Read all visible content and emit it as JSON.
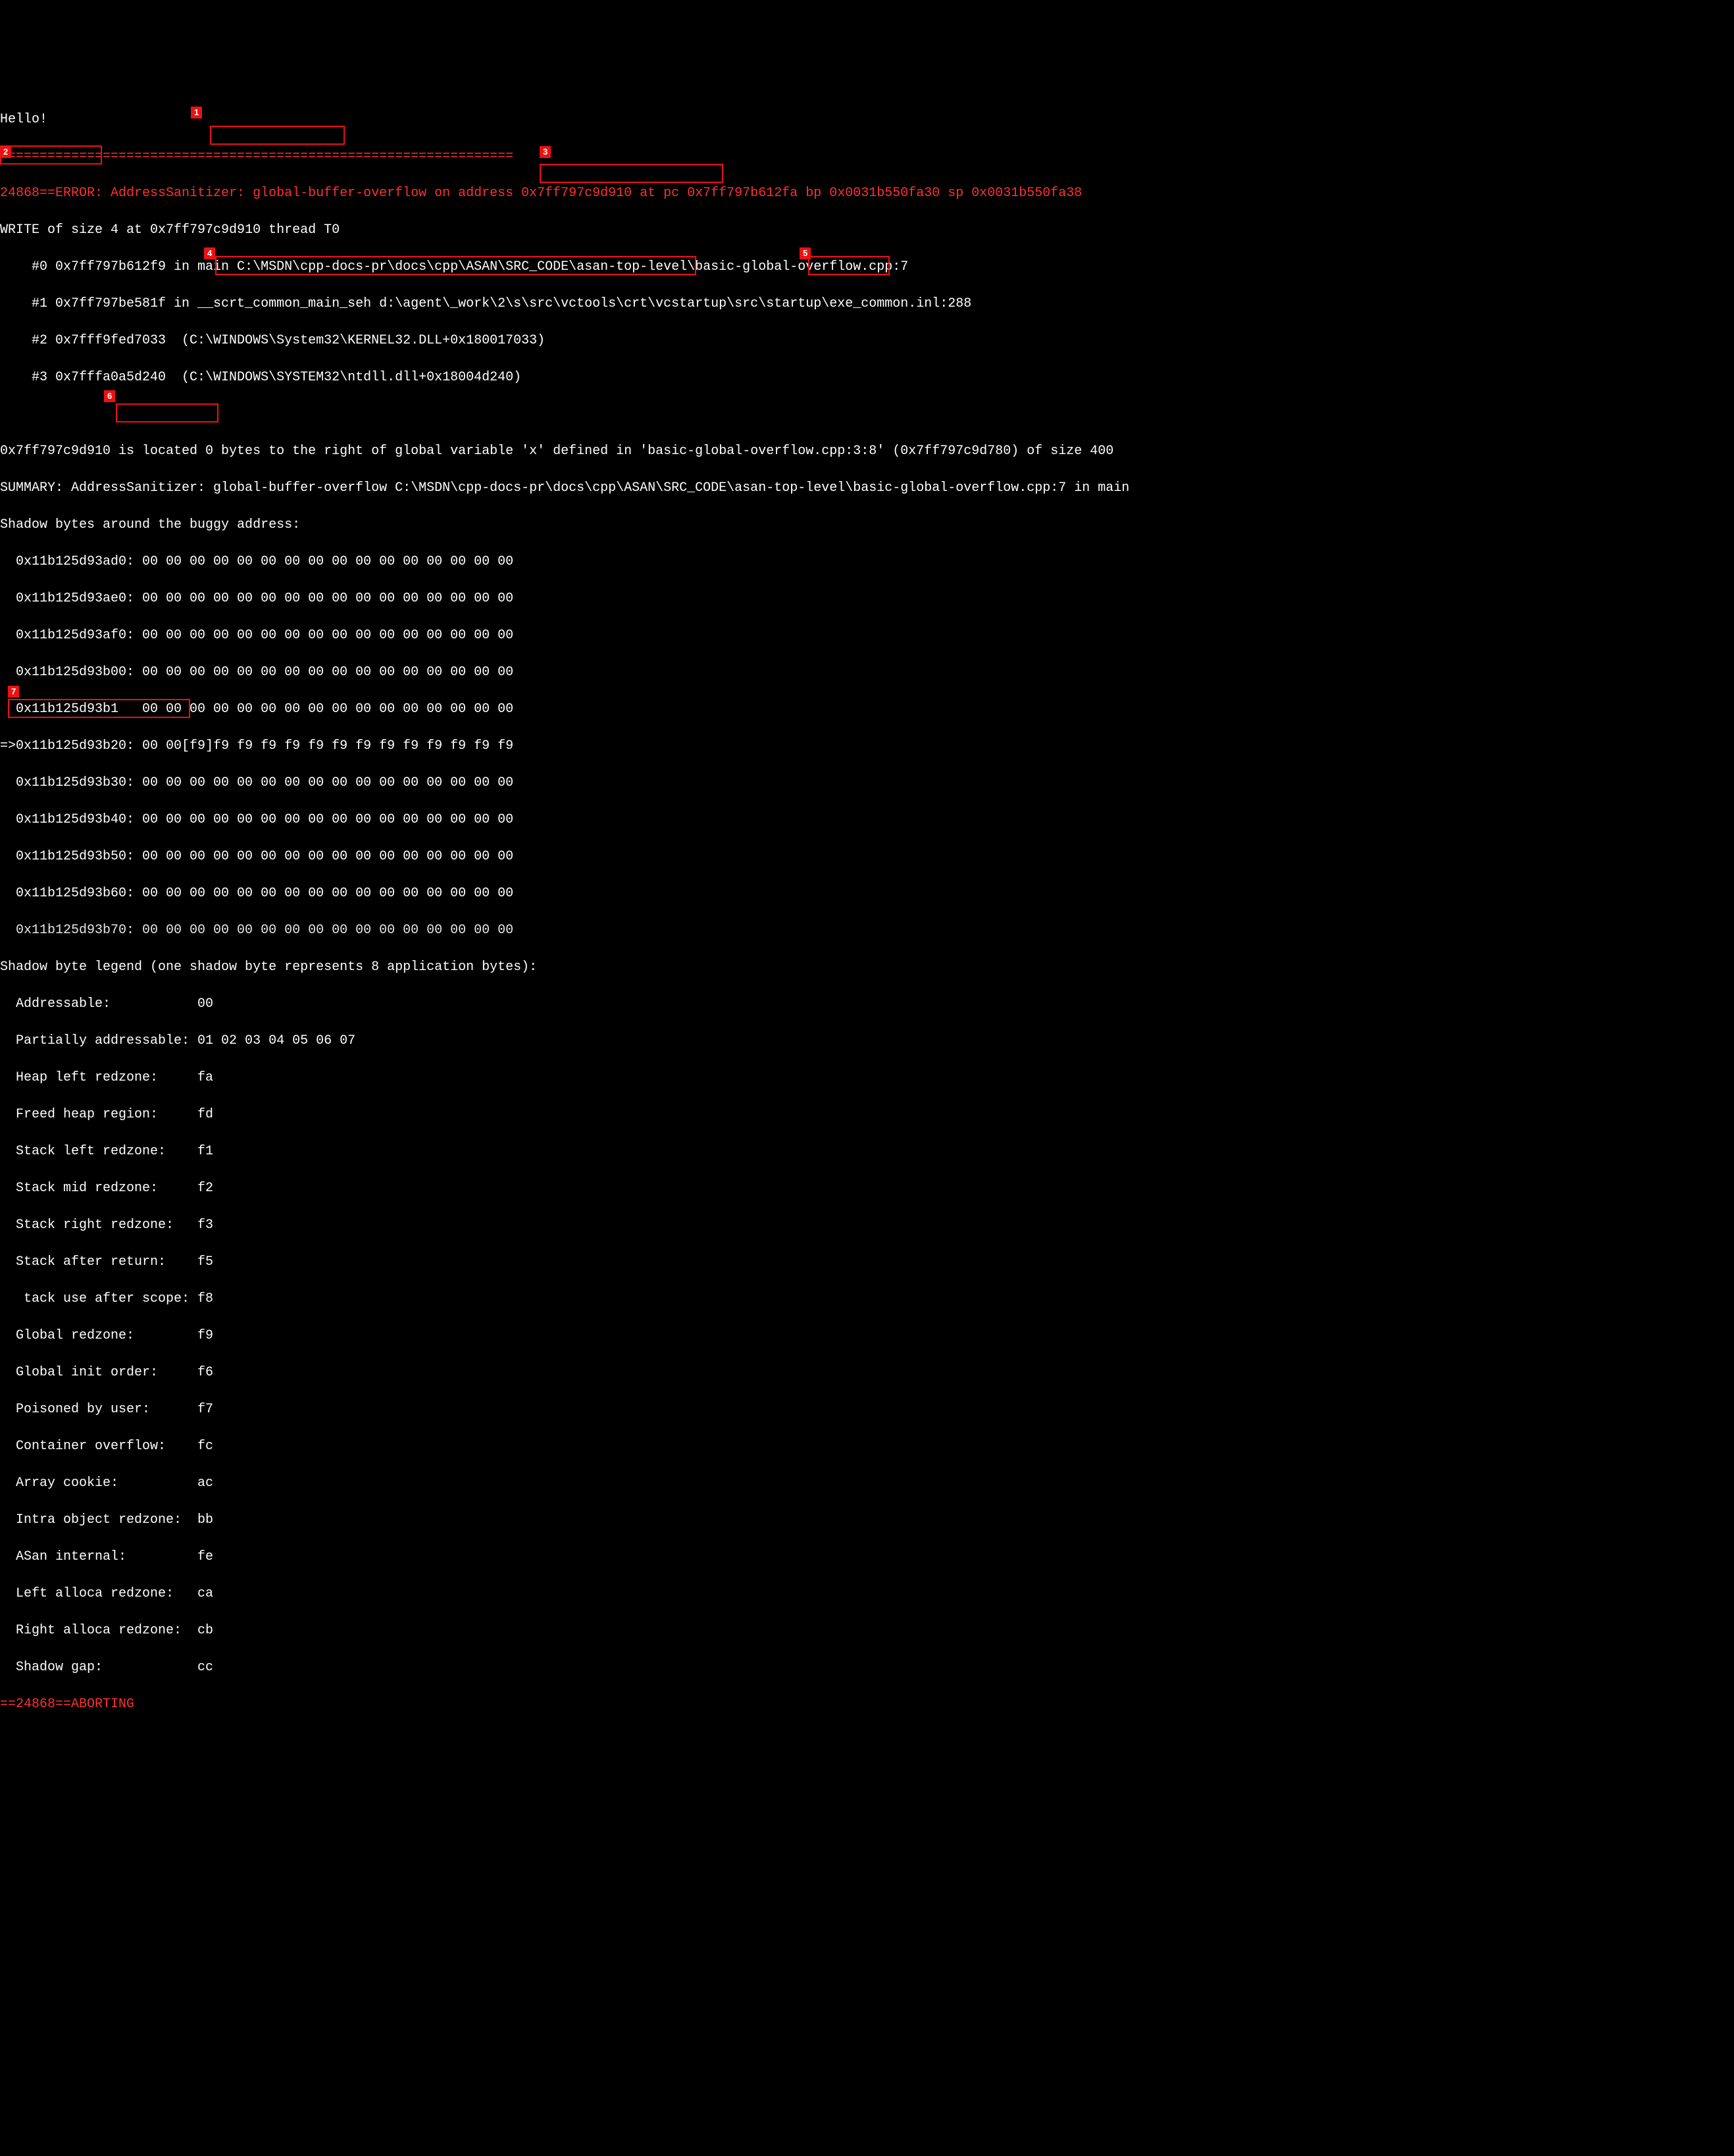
{
  "greeting": "Hello!",
  "divider": "=================================================================",
  "error_prefix": "24868==ERROR: AddressSanitizer: ",
  "error_type": "global-buffer-overflow",
  "error_on_addr": " on address 0x7ff797c9d910 at pc 0x7ff797b612fa bp 0x0031b550fa30 sp 0x0031b550fa38",
  "write_of_size": "WRITE of size 4",
  "write_at": " at 0x7ff797c9d910 thread T0",
  "frames": [
    "    #0 0x7ff797b612f9 in main C:\\MSDN\\cpp-docs-pr\\docs\\cpp\\ASAN\\SRC_CODE\\asan-top-level\\basic-global-overflow.cpp:7",
    "    #1 0x7ff797be581f in __scrt_common_main_seh d:\\agent\\_work\\2\\s\\src\\vctools\\crt\\vcstartup\\src\\startup\\exe_common.inl:288",
    "    #2 0x7fff9fed7033  (C:\\WINDOWS\\System32\\KERNEL32.DLL+0x180017033)",
    "    #3 0x7fffa0a5d240  (C:\\WINDOWS\\SYSTEM32\\ntdll.dll+0x18004d240)"
  ],
  "located_prefix": "0x7ff797c9d910 is located 0 bytes ",
  "located_mid": "to the right of global variable 'x' defined in 'basic-global-overflow.cpp:3:8'",
  "located_paren": " (0x7ff797c9d780) ",
  "located_size": "of size 400",
  "summary": "SUMMARY: AddressSanitizer: global-buffer-overflow C:\\MSDN\\cpp-docs-pr\\docs\\cpp\\ASAN\\SRC_CODE\\asan-top-level\\basic-global-overflow.cpp:7 in main",
  "shadow_header": "Shadow bytes around the buggy address:",
  "shadow_rows": [
    "  0x11b125d93ad0: 00 00 00 00 00 00 00 00 00 00 00 00 00 00 00 00",
    "  0x11b125d93ae0: 00 00 00 00 00 00 00 00 00 00 00 00 00 00 00 00",
    "  0x11b125d93af0: 00 00 00 00 00 00 00 00 00 00 00 00 00 00 00 00",
    "  0x11b125d93b00: 00 00 00 00 00 00 00 00 00 00 00 00 00 00 00 00",
    "  0x11b125d93b1   00 00 00 00 00 00 00 00 00 00 00 00 00 00 00 00"
  ],
  "shadow_current_prefix": "=>0x11b125d93b20: ",
  "shadow_current_hl": "00 00[f9]f9 f9 ",
  "shadow_current_rest": "f9 f9 f9 f9 f9 f9 f9 f9 f9 f9 f9",
  "shadow_rows2": [
    "  0x11b125d93b30: 00 00 00 00 00 00 00 00 00 00 00 00 00 00 00 00",
    "  0x11b125d93b40: 00 00 00 00 00 00 00 00 00 00 00 00 00 00 00 00",
    "  0x11b125d93b50: 00 00 00 00 00 00 00 00 00 00 00 00 00 00 00 00",
    "  0x11b125d93b60: 00 00 00 00 00 00 00 00 00 00 00 00 00 00 00 00",
    "  0x11b125d93b70: 00 00 00 00 00 00 00 00 00 00 00 00 00 00 00 00"
  ],
  "legend_header": "Shadow byte legend (one shadow byte represents 8 application bytes):",
  "legend": [
    "  Addressable:           00",
    "  Partially addressable: 01 02 03 04 05 06 07",
    "  Heap left redzone:     fa",
    "  Freed heap region:     fd",
    "  Stack left redzone:    f1",
    "  Stack mid redzone:     f2",
    "  Stack right redzone:   f3",
    "  Stack after return:    f5",
    "   tack use after scope: f8",
    "  Global redzone:        f9",
    "  Global init order:     f6",
    "  Poisoned by user:      f7",
    "  Container overflow:    fc",
    "  Array cookie:          ac",
    "  Intra object redzone:  bb",
    "  ASan internal:         fe",
    "  Left alloca redzone:   ca",
    "  Right alloca redzone:  cb",
    "  Shadow gap:            cc"
  ],
  "aborting": "==24868==ABORTING",
  "annots": {
    "n1": "1",
    "n2": "2",
    "n3": "3",
    "n4": "4",
    "n5": "5",
    "n6": "6",
    "n7": "7"
  }
}
